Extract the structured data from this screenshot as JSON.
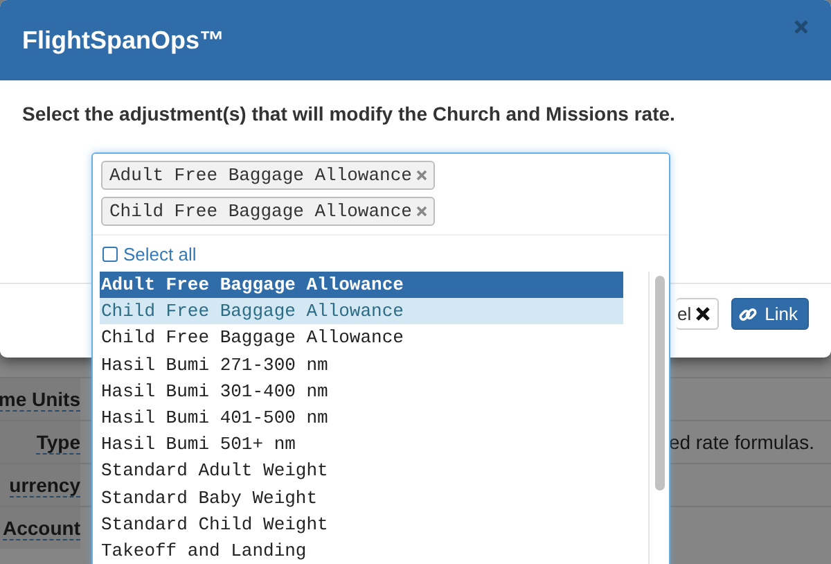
{
  "background": {
    "rows": [
      {
        "label": "me Units"
      },
      {
        "label": "Type",
        "value": "ed rate formulas."
      },
      {
        "label": "urrency"
      },
      {
        "label": "Account"
      }
    ]
  },
  "modal": {
    "title": "FlightSpanOps™",
    "prompt": "Select the adjustment(s) that will modify the Church and Missions rate.",
    "buttons": [
      {
        "kind": "cancel",
        "label": "el"
      },
      {
        "kind": "link",
        "label": "Link"
      }
    ]
  },
  "select": {
    "tags": [
      "Adult Free Baggage Allowance",
      "Child Free Baggage Allowance"
    ],
    "select_all": {
      "label": "Select all",
      "checked": false
    },
    "options": [
      {
        "label": "Adult Free Baggage Allowance",
        "selected": true,
        "highlighted": false
      },
      {
        "label": "Child Free Baggage Allowance",
        "selected": false,
        "highlighted": true
      },
      {
        "label": "Child Free Baggage Allowance",
        "selected": false,
        "highlighted": false
      },
      {
        "label": "Hasil Bumi 271-300 nm",
        "selected": false,
        "highlighted": false
      },
      {
        "label": "Hasil Bumi 301-400 nm",
        "selected": false,
        "highlighted": false
      },
      {
        "label": "Hasil Bumi 401-500 nm",
        "selected": false,
        "highlighted": false
      },
      {
        "label": "Hasil Bumi 501+ nm",
        "selected": false,
        "highlighted": false
      },
      {
        "label": "Standard Adult Weight",
        "selected": false,
        "highlighted": false
      },
      {
        "label": "Standard Baby Weight",
        "selected": false,
        "highlighted": false
      },
      {
        "label": "Standard Child Weight",
        "selected": false,
        "highlighted": false
      },
      {
        "label": "Takeoff and Landing",
        "selected": false,
        "highlighted": false
      }
    ]
  }
}
